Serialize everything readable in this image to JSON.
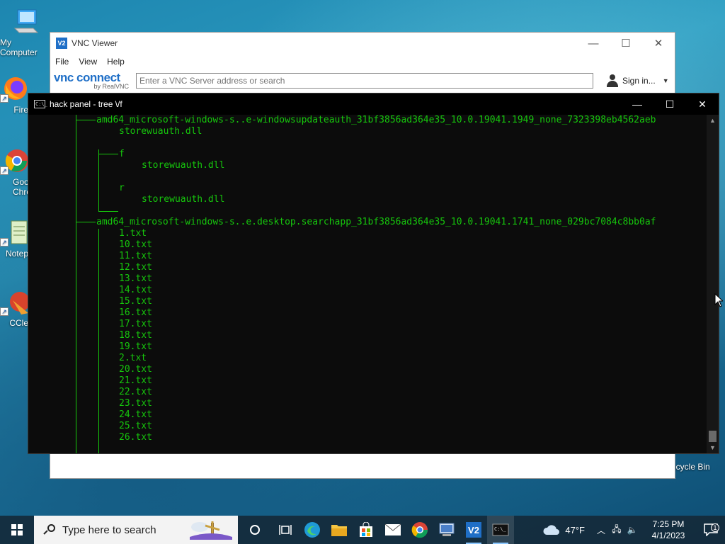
{
  "desktop": {
    "icons": [
      {
        "label": "My Computer"
      },
      {
        "label": "Fire"
      },
      {
        "label": "Goo Chro"
      },
      {
        "label": "Notep"
      },
      {
        "label": "CCle"
      },
      {
        "label": "ecycle Bin"
      }
    ]
  },
  "vnc": {
    "title": "VNC Viewer",
    "logo_text": "V2",
    "menu": [
      "File",
      "View",
      "Help"
    ],
    "brand": {
      "name": "vnc connect",
      "sub": "by RealVNC"
    },
    "search_placeholder": "Enter a VNC Server address or search",
    "sign_in": "Sign in..."
  },
  "console": {
    "title": "hack panel  - tree  \\/f",
    "icon_text": "C:\\_",
    "lines": [
      "amd64_microsoft-windows-s..e-windowsupdateauth_31bf3856ad364e35_10.0.19041.1949_none_7323398eb4562aeb",
      "storewuauth.dll",
      "f",
      "storewuauth.dll",
      "r",
      "storewuauth.dll",
      "amd64_microsoft-windows-s..e.desktop.searchapp_31bf3856ad364e35_10.0.19041.1741_none_029bc7084c8bb0af",
      "1.txt",
      "10.txt",
      "11.txt",
      "12.txt",
      "13.txt",
      "14.txt",
      "15.txt",
      "16.txt",
      "17.txt",
      "18.txt",
      "19.txt",
      "2.txt",
      "20.txt",
      "21.txt",
      "22.txt",
      "23.txt",
      "24.txt",
      "25.txt",
      "26.txt"
    ]
  },
  "taskbar": {
    "search_placeholder": "Type here to search",
    "apps": [
      "task-view",
      "edge",
      "file-explorer",
      "microsoft-store",
      "mail",
      "chrome",
      "network-app",
      "vnc-viewer",
      "terminal"
    ],
    "weather": "47°F",
    "time": "7:25 PM",
    "date": "4/1/2023",
    "notification_count": "1"
  },
  "colors": {
    "terminal_text": "#16c60c",
    "terminal_bg": "#0c0c0c",
    "vnc_brand": "#1f6fc7"
  }
}
